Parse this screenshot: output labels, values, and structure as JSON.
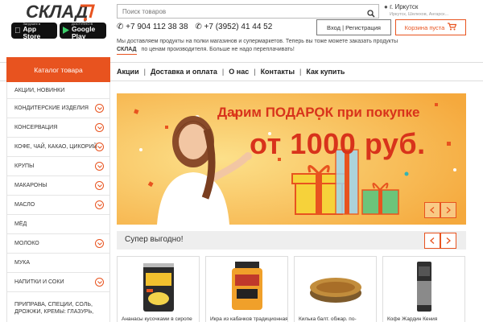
{
  "header": {
    "logo_text": "СКЛАД",
    "app_store": {
      "small": "Загрузите в",
      "big": "App Store"
    },
    "google_play": {
      "small": "ДОСТУПНО В",
      "big": "Google Play"
    },
    "search_placeholder": "Поиск товаров",
    "city": "г. Иркутск",
    "city_sub": "Иркутск, Шелехов, Ангарск...",
    "phone1": "+7 904 112 38 38",
    "phone2": "+7 (3952) 41 44 52",
    "login_label": "Вход | Регистрация",
    "cart_label": "Корзина пуста",
    "description_line1": "Мы доставляем продукты на полки магазинов и супермаркетов. Теперь вы тоже можете заказать продукты",
    "description_logo": "СКЛАД",
    "description_line2": "по ценам производителя. Больше не надо переплачивать!"
  },
  "nav": {
    "catalog_label": "Каталог товара",
    "items": [
      "Акции",
      "Доставка и оплата",
      "О нас",
      "Контакты",
      "Как купить"
    ],
    "separator": "|"
  },
  "sidebar": {
    "items": [
      {
        "label": "АКЦИИ, НОВИНКИ",
        "has_chevron": false
      },
      {
        "label": "КОНДИТЕРСКИЕ ИЗДЕЛИЯ",
        "has_chevron": true
      },
      {
        "label": "КОНСЕРВАЦИЯ",
        "has_chevron": true
      },
      {
        "label": "КОФЕ, ЧАЙ, КАКАО, ЦИКОРИЙ",
        "has_chevron": true
      },
      {
        "label": "КРУПЫ",
        "has_chevron": true
      },
      {
        "label": "МАКАРОНЫ",
        "has_chevron": true
      },
      {
        "label": "МАСЛО",
        "has_chevron": true
      },
      {
        "label": "МЁД",
        "has_chevron": false
      },
      {
        "label": "МОЛОКО",
        "has_chevron": true
      },
      {
        "label": "МУКА",
        "has_chevron": false
      },
      {
        "label": "НАПИТКИ И СОКИ",
        "has_chevron": true
      },
      {
        "label": "ПРИПРАВА, СПЕЦИИ, СОЛЬ, ДРОЖЖИ, КРЕМЫ: ГЛАЗУРЬ,",
        "has_chevron": false
      }
    ]
  },
  "banner": {
    "line1": "Дарим ПОДАРОК при покупке",
    "line2": "от 1000 руб.",
    "prev_icon": "chevron-left-icon",
    "next_icon": "chevron-right-icon"
  },
  "super": {
    "title": "Супер выгодно!"
  },
  "products": [
    {
      "name": "Ананасы кусочками в сиропе",
      "kind": "can"
    },
    {
      "name": "Икра из кабачков традиционная",
      "kind": "jar"
    },
    {
      "name": "Килька балт. обжар. по-",
      "kind": "tin"
    },
    {
      "name": "Кофе Жардин Кения",
      "kind": "coffee"
    }
  ],
  "colors": {
    "accent": "#e8531f",
    "banner_bg": "#f7b54a",
    "banner_text": "#d8331b"
  }
}
